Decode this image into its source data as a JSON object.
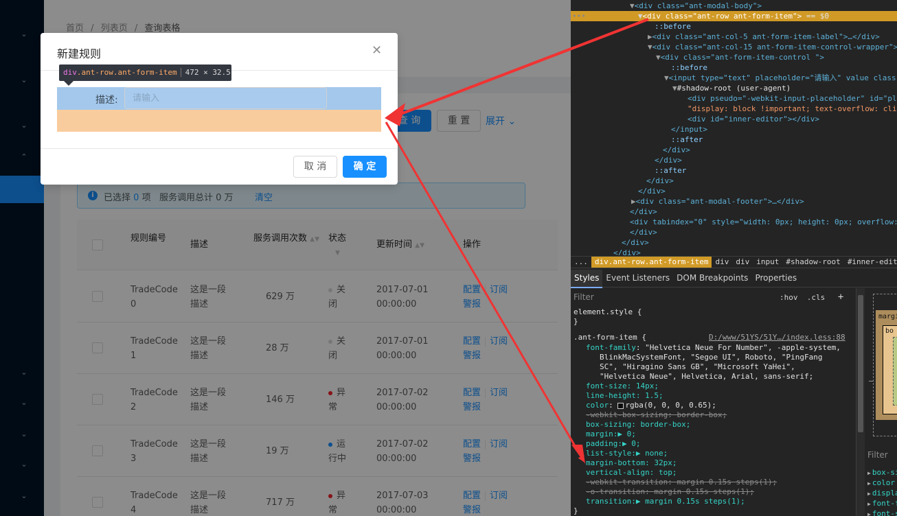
{
  "page": {
    "breadcrumb": [
      "首页",
      "/",
      "列表页",
      "/",
      "查询表格"
    ],
    "query_button": "查 询",
    "reset_button": "重 置",
    "expand_link": "展开",
    "alert": {
      "prefix": "已选择",
      "selected_count": "0",
      "mid": "项   服务调用总计 0 万",
      "clear": "清空"
    },
    "table": {
      "headers": {
        "rule_id": "规则编号",
        "description": "描述",
        "calls": "服务调用次数",
        "status": "状态",
        "updated": "更新时间",
        "actions": "操作"
      },
      "rows": [
        {
          "id": "TradeCode 0",
          "desc": "这是一段描述",
          "calls": "629 万",
          "status": "关闭",
          "status_color": "#d9d9d9",
          "time": "2017-07-01 00:00:00"
        },
        {
          "id": "TradeCode 1",
          "desc": "这是一段描述",
          "calls": "28 万",
          "status": "关闭",
          "status_color": "#d9d9d9",
          "time": "2017-07-01 00:00:00"
        },
        {
          "id": "TradeCode 2",
          "desc": "这是一段描述",
          "calls": "146 万",
          "status": "异常",
          "status_color": "#f5222d",
          "time": "2017-07-02 00:00:00"
        },
        {
          "id": "TradeCode 3",
          "desc": "这是一段描述",
          "calls": "19 万",
          "status": "运行中",
          "status_color": "#1890ff",
          "time": "2017-07-02 00:00:00"
        },
        {
          "id": "TradeCode 4",
          "desc": "这是一段描述",
          "calls": "717 万",
          "status": "异常",
          "status_color": "#f5222d",
          "time": "2017-07-03 00:00:00"
        }
      ],
      "action_config": "配置",
      "action_subscribe": "订阅",
      "action_alarm": "警报"
    }
  },
  "modal": {
    "title": "新建规则",
    "close_icon": "close-icon",
    "field_label": "描述:",
    "field_placeholder": "请输入",
    "cancel_button": "取 消",
    "ok_button": "确 定",
    "tooltip_tag": "div",
    "tooltip_class": ".ant-row.ant-form-item",
    "tooltip_size": "472 × 32.5"
  },
  "devtools": {
    "dom_lines": {
      "l0": "<div class=\"ant-modal-body\">",
      "l1a": "<div class=\"ant-row ant-form-item\">",
      "l1b": " == $0",
      "l2": "::before",
      "l3": "<div class=\"ant-col-5 ant-form-item-label\">…</div>",
      "l4": "<div class=\"ant-col-15 ant-form-item-control-wrapper\">",
      "l5": "<div class=\"ant-form-item-control \">",
      "l6": "::before",
      "l7": "<input type=\"text\" placeholder=\"请输入\" value class",
      "l8": "#shadow-root (user-agent)",
      "l9": "<div pseudo=\"-webkit-input-placeholder\" id=\"pla",
      "l10": "\"display: block !important; text-overflow: clip",
      "l11": "<div id=\"inner-editor\"></div>",
      "l12": "</input>",
      "l13": "::after",
      "l14": "</div>",
      "l15": "</div>",
      "l16": "::after",
      "l17": "</div>",
      "l18": "</div>",
      "l19": "<div class=\"ant-modal-footer\">…</div>",
      "l20": "</div>",
      "l21": "<div tabindex=\"0\" style=\"width: 0px; height: 0px; overflow:",
      "l22": "</div>",
      "l23": "</div>",
      "l24": "</div>"
    },
    "crumbs": [
      "...",
      "div.ant-row.ant-form-item",
      "div",
      "div",
      "input",
      "#shadow-root",
      "#inner-editor"
    ],
    "tabs": [
      "Styles",
      "Event Listeners",
      "DOM Breakpoints",
      "Properties"
    ],
    "filter_placeholder": "Filter",
    "hov_cls": ":hov  .cls",
    "element_style": "element.style {",
    "close_brace": "}",
    "rule_selector": ".ant-form-item {",
    "rule_source": "D:/www/51YS/51Y…/index.less:88",
    "props": {
      "ff_name": "font-family",
      "ff_val1": "\"Helvetica Neue For Number\", -apple-system,",
      "ff_val2": "BlinkMacSystemFont, \"Segoe UI\", Roboto, \"PingFang",
      "ff_val3": "SC\", \"Hiragino Sans GB\", \"Microsoft YaHei\",",
      "ff_val4": "\"Helvetica Neue\", Helvetica, Arial, sans-serif;",
      "fs": "font-size: 14px;",
      "lh": "line-height: 1.5;",
      "color_name": "color",
      "color_val": "rgba(0, 0, 0, 0.65);",
      "wbs": "-webkit-box-sizing: border-box;",
      "bs": "box-sizing: border-box;",
      "margin": "margin:▶ 0;",
      "padding": "padding:▶ 0;",
      "list_style": "list-style:▶ none;",
      "margin_bottom": "margin-bottom: 32px;",
      "va": "vertical-align: top;",
      "wt": "-webkit-transition: margin 0.15s steps(1);",
      "ot": "-o-transition: margin 0.15s steps(1);",
      "tr": "transition:▶ margin 0.15s steps(1);"
    },
    "box_model": {
      "margin_label": "margin",
      "border_label": "bo",
      "dash": "–"
    },
    "computed_filter": "Filter",
    "computed": [
      "box-siz",
      "color",
      "display",
      "font-fa",
      "font-si"
    ]
  }
}
